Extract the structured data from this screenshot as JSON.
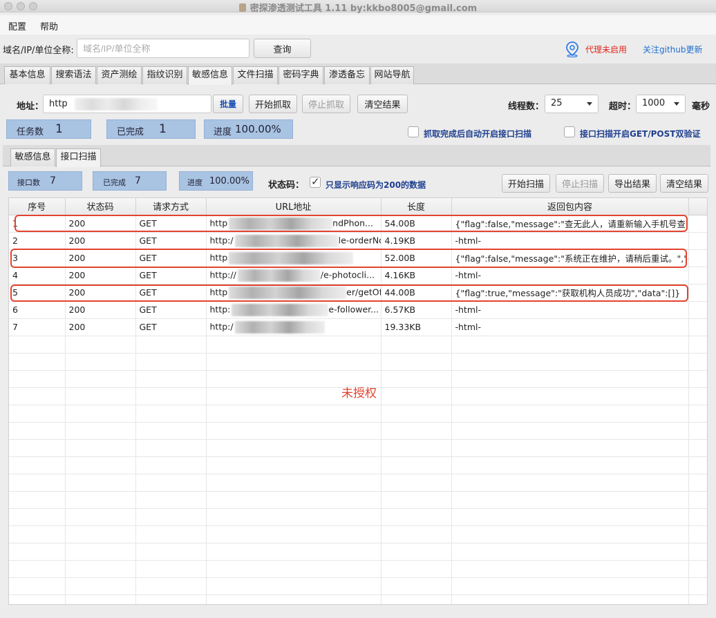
{
  "window": {
    "title": "密探渗透测试工具 1.11 by:kkbo8005@gmail.com"
  },
  "menu": [
    "配置",
    "帮助"
  ],
  "search": {
    "label": "域名/IP/单位全称:",
    "placeholder": "域名/IP/单位全称",
    "button": "查询"
  },
  "status_links": {
    "proxy": "代理未启用",
    "github": "关注github更新"
  },
  "main_tabs": [
    "基本信息",
    "搜索语法",
    "资产测绘",
    "指纹识别",
    "敏感信息",
    "文件扫描",
    "密码字典",
    "渗透备忘",
    "网站导航"
  ],
  "main_tab_active": "敏感信息",
  "crawl": {
    "address_label": "地址：",
    "address_value": "http",
    "batch_button": "批量",
    "start_button": "开始抓取",
    "stop_button": "停止抓取",
    "clear_button": "清空结果",
    "threads_label": "线程数：",
    "threads_value": "25",
    "timeout_label": "超时：",
    "timeout_value": "1000",
    "timeout_unit": "毫秒"
  },
  "crawl_stats": {
    "tasks_label": "任务数",
    "tasks_value": "1",
    "done_label": "已完成",
    "done_value": "1",
    "progress_label": "进度",
    "progress_value": "100.00%"
  },
  "options": {
    "auto_scan": "抓取完成后自动开启接口扫描",
    "dual_verify": "接口扫描开启GET/POST双验证"
  },
  "sub_tabs": [
    "敏感信息",
    "接口扫描"
  ],
  "sub_tab_active": "接口扫描",
  "scan_stats": {
    "api_label": "接口数",
    "api_value": "7",
    "done_label": "已完成",
    "done_value": "7",
    "progress_label": "进度",
    "progress_value": "100.00%"
  },
  "scan_filter": {
    "label": "状态码：",
    "checkbox_label": "只显示响应码为200的数据"
  },
  "scan_buttons": {
    "start": "开始扫描",
    "stop": "停止扫描",
    "export": "导出结果",
    "clear": "清空结果"
  },
  "table": {
    "columns": [
      "序号",
      "状态码",
      "请求方式",
      "URL地址",
      "长度",
      "返回包内容"
    ],
    "rows": [
      {
        "id": "1",
        "status": "200",
        "method": "GET",
        "url_start": "http",
        "url_end": "ndPhon...",
        "length": "54.00B",
        "body": "{\"flag\":false,\"message\":\"查无此人，请重新输入手机号查..."
      },
      {
        "id": "2",
        "status": "200",
        "method": "GET",
        "url_start": "http:/",
        "url_end": "le-orderNo...",
        "length": "4.19KB",
        "body": "-html-"
      },
      {
        "id": "3",
        "status": "200",
        "method": "GET",
        "url_start": "http",
        "url_end": "",
        "length": "52.00B",
        "body": "{\"flag\":false,\"message\":\"系统正在维护，请稍后重试。\",\"d..."
      },
      {
        "id": "4",
        "status": "200",
        "method": "GET",
        "url_start": "http://",
        "url_end": "/e-photocli...",
        "length": "4.16KB",
        "body": "-html-"
      },
      {
        "id": "5",
        "status": "200",
        "method": "GET",
        "url_start": "http",
        "url_end": "er/getOffice...",
        "length": "44.00B",
        "body": "{\"flag\":true,\"message\":\"获取机构人员成功\",\"data\":[]}"
      },
      {
        "id": "6",
        "status": "200",
        "method": "GET",
        "url_start": "http:",
        "url_end": "e-follower...",
        "length": "6.57KB",
        "body": "-html-"
      },
      {
        "id": "7",
        "status": "200",
        "method": "GET",
        "url_start": "http:/",
        "url_end": "",
        "length": "19.33KB",
        "body": "-html-"
      }
    ]
  },
  "annotation": "未授权"
}
